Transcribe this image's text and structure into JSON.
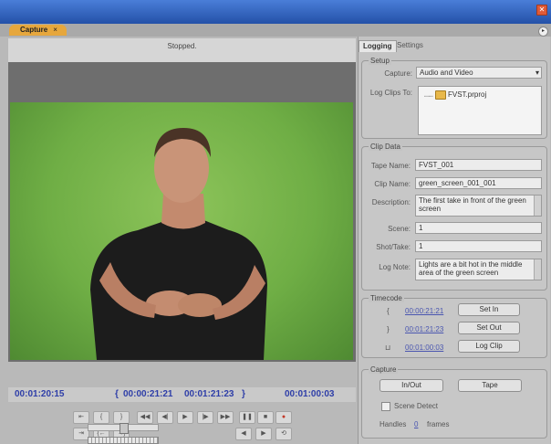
{
  "window": {
    "close_label": "✕"
  },
  "panel": {
    "tab_label": "Capture",
    "tab_close": "×",
    "menu_icon": "panel-menu-icon",
    "menu_glyph": "▸"
  },
  "preview": {
    "status": "Stopped."
  },
  "timecodes": {
    "current": "00:01:20:15",
    "in_point": "00:00:21:21",
    "out_point": "00:01:21:23",
    "duration": "00:01:00:03",
    "in_bracket": "{",
    "out_bracket": "}"
  },
  "transport": {
    "buttons": [
      {
        "name": "set-in-point-button",
        "glyph": "⇤"
      },
      {
        "name": "go-to-in-button",
        "glyph": "{"
      },
      {
        "name": "go-to-out-button",
        "glyph": "}"
      },
      {
        "name": "rewind-button",
        "glyph": "◀◀"
      },
      {
        "name": "step-back-button",
        "glyph": "◀|"
      },
      {
        "name": "play-button",
        "glyph": "▶"
      },
      {
        "name": "step-forward-button",
        "glyph": "|▶"
      },
      {
        "name": "fast-forward-button",
        "glyph": "▶▶"
      },
      {
        "name": "pause-button",
        "glyph": "❚❚"
      },
      {
        "name": "stop-button",
        "glyph": "■"
      },
      {
        "name": "record-button",
        "glyph": "●"
      },
      {
        "name": "set-out-point-button",
        "glyph": "⇥"
      },
      {
        "name": "go-to-in-point-button",
        "glyph": "{←"
      },
      {
        "name": "go-to-out-point-button",
        "glyph": "→}"
      },
      {
        "name": "slow-reverse-button",
        "glyph": "◀"
      },
      {
        "name": "slow-play-button",
        "glyph": "▶"
      },
      {
        "name": "scene-search-button",
        "glyph": "⟲"
      }
    ]
  },
  "right_panel": {
    "tabs": [
      "Logging",
      "Settings"
    ],
    "setup": {
      "title": "Setup",
      "capture_label": "Capture:",
      "capture_value": "Audio and Video",
      "log_clips_label": "Log Clips To:",
      "project_name": "FVST.prproj"
    },
    "clip_data": {
      "title": "Clip Data",
      "tape_name_label": "Tape Name:",
      "tape_name": "FVST_001",
      "clip_name_label": "Clip Name:",
      "clip_name": "green_screen_001_001",
      "description_label": "Description:",
      "description": "The first take in front of the green screen",
      "scene_label": "Scene:",
      "scene": "1",
      "shot_label": "Shot/Take:",
      "shot": "1",
      "log_note_label": "Log Note:",
      "log_note": "Lights are a bit hot in the middle area of the green screen"
    },
    "timecode": {
      "title": "Timecode",
      "in_value": "00:00:21:21",
      "out_value": "00:01:21:23",
      "duration_value": "00:01:00:03",
      "set_in": "Set In",
      "set_out": "Set Out",
      "log_clip": "Log Clip",
      "in_glyph": "{",
      "out_glyph": "}",
      "dur_glyph": "⊔"
    },
    "capture": {
      "title": "Capture",
      "in_out": "In/Out",
      "tape": "Tape",
      "scene_detect": "Scene Detect",
      "handles_label": "Handles",
      "handles_value": "0",
      "frames_label": "frames"
    }
  },
  "colors": {
    "accent_tab": "#e6a73d",
    "timecode_blue": "#2e3ea8",
    "title_bar": "#2f5fb8",
    "green_screen": "#7ab84e"
  }
}
